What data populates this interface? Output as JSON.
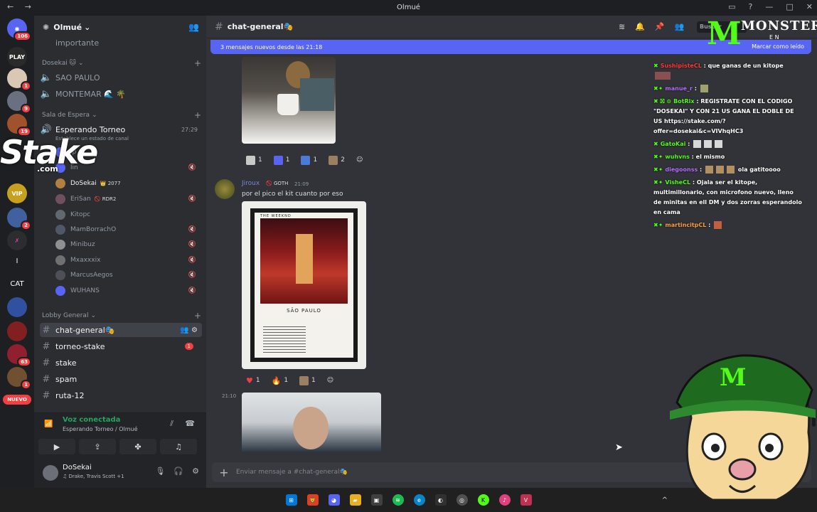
{
  "window": {
    "title": "Olmué",
    "nav_arrows": "←  →"
  },
  "server": {
    "name": "Olmué"
  },
  "guild_badges": [
    "106",
    "1",
    "9",
    "19",
    "2",
    "1",
    "63",
    "1"
  ],
  "guild_labels": {
    "cat": "CAT",
    "nuevo": "NUEVO",
    "play": "PLAY",
    "vip": "VIP"
  },
  "stake_overlay": {
    "brand": "Stake",
    "suffix": ".com"
  },
  "channels": {
    "importante": "importante",
    "cat_dosekai": "Dosekai 🐱",
    "sao_paulo": "SAO PAULO",
    "montemar": "MONTEMAR 🌊 🌴",
    "cat_espera": "Sala de Espera",
    "esperando": "Esperando Torneo",
    "esperando_time": "27:29",
    "esperando_status": "Establece un estado de canal",
    "voice_users": [
      {
        "name": "lp",
        "badge": ""
      },
      {
        "name": "lin",
        "badge": ""
      },
      {
        "name": "DoSekai",
        "badge": "👑 2077"
      },
      {
        "name": "EriSan",
        "badge": "🚫 RDR2"
      },
      {
        "name": "Kitopc",
        "badge": ""
      },
      {
        "name": "MamBorrachO",
        "badge": ""
      },
      {
        "name": "Minibuz",
        "badge": ""
      },
      {
        "name": "Mxaxxxix",
        "badge": ""
      },
      {
        "name": "MarcusAegos",
        "badge": ""
      },
      {
        "name": "WUHANS",
        "badge": ""
      }
    ],
    "cat_lobby": "Lobby General",
    "text": [
      {
        "name": "chat-general🎭",
        "unread": ""
      },
      {
        "name": "torneo-stake",
        "unread": "1"
      },
      {
        "name": "stake",
        "unread": ""
      },
      {
        "name": "spam",
        "unread": ""
      },
      {
        "name": "ruta-12",
        "unread": ""
      }
    ]
  },
  "voice_panel": {
    "status": "Voz conectada",
    "location": "Esperando Torneo / Olmué"
  },
  "user_panel": {
    "name": "DoSekai",
    "activity": "♫ Drake, Travis Scott +1"
  },
  "header": {
    "channel": "chat-general🎭",
    "search_placeholder": "Buscar"
  },
  "new_messages": {
    "text": "3 mensajes nuevos desde las 21:18",
    "mark_read": "Marcar como leído"
  },
  "messages": {
    "reactions1": [
      "1",
      "1",
      "1",
      "2"
    ],
    "author": "Jiroux",
    "tag": "🚫 GOTH",
    "time": "21:09",
    "text": "por el pico el kit cuanto por eso",
    "poster_title": "SÃO PAULO",
    "poster_brand": "THE WEEKND",
    "reactions2": [
      "1",
      "1",
      "1"
    ],
    "time2": "21:10"
  },
  "composer": {
    "placeholder": "Enviar mensaje a #chat-general🎭"
  },
  "stream_chat": [
    {
      "user": "SushipisteCL",
      "color": "#ff3b3b",
      "text": "que ganas de un kitope"
    },
    {
      "user": "manue_r",
      "color": "#b86dff",
      "text": ""
    },
    {
      "user": "BotRix",
      "color": "#53fc18",
      "text": "REGISTRATE CON EL CODIGO \"DOSEKAI\" Y CON 21 US GANA EL DOBLE DE US https://stake.com/?offer=dosekai&c=VIVhqHC3"
    },
    {
      "user": "GatoKai",
      "color": "#53fc18",
      "text": ""
    },
    {
      "user": "wuhvns",
      "color": "#53fc18",
      "text": "el mismo"
    },
    {
      "user": "diegoonss",
      "color": "#b86dff",
      "text": "ola gatitoooo"
    },
    {
      "user": "VisheCL",
      "color": "#53fc18",
      "text": "Ojala ser el kitope, multimillonario, con microfono nuevo, lleno de minitas en ell DM y dos zorras esperandolo en cama"
    },
    {
      "user": "martincitpCL",
      "color": "#ff9f40",
      "text": ""
    }
  ],
  "monster_overlay": {
    "brand": "MONSTER",
    "sub": "E N"
  },
  "colors": {
    "accent": "#5865f2",
    "green": "#53fc18",
    "unread": "#f23f42"
  }
}
